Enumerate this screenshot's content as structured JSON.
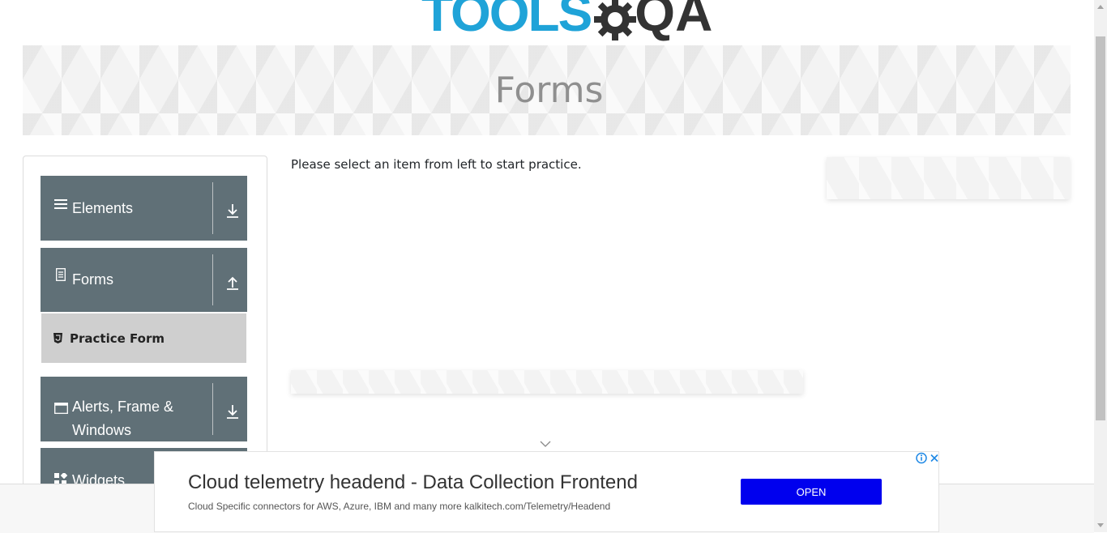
{
  "logo": {
    "text": "TOOLS",
    "accent_text": "QA"
  },
  "banner": {
    "title": "Forms"
  },
  "sidebar": {
    "groups": [
      {
        "label": "Elements",
        "icon": "list-icon",
        "toggle": "expand"
      },
      {
        "label": "Forms",
        "icon": "document-icon",
        "toggle": "collapse",
        "items": [
          {
            "label": "Practice Form",
            "icon": "html5-icon"
          }
        ]
      },
      {
        "label": "Alerts, Frame & Windows",
        "icon": "window-icon",
        "toggle": "expand"
      },
      {
        "label": "Widgets",
        "icon": "widgets-icon"
      }
    ]
  },
  "main": {
    "instruction": "Please select an item from left to start practice."
  },
  "ad": {
    "title": "Cloud telemetry headend - Data Collection Frontend",
    "subtitle": "Cloud Specific connectors for AWS, Azure, IBM and many more kalkitech.com/Telemetry/Headend",
    "button": "OPEN"
  },
  "colors": {
    "sidebar_header": "#607077",
    "active_item": "#cfcfcf",
    "ad_button": "#0000ee",
    "logo_blue": "#1fa3d8"
  }
}
